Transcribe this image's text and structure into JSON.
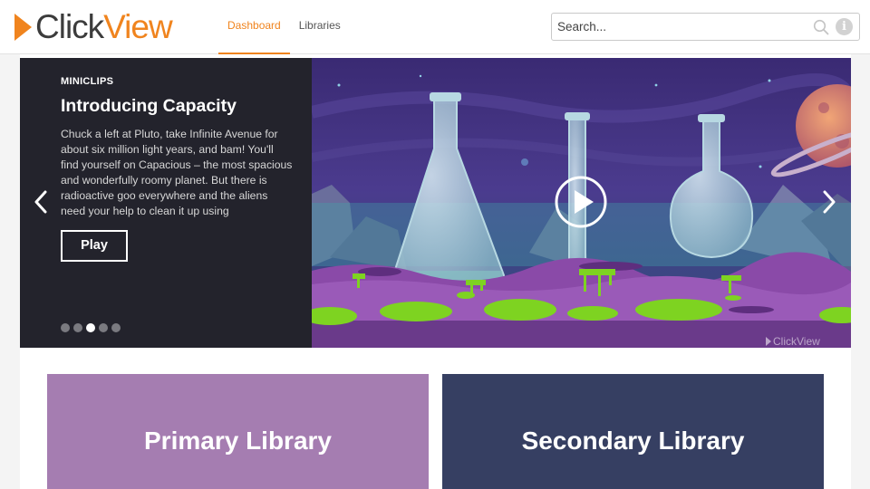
{
  "brand": {
    "logo_part1": "Click",
    "logo_part2": "View",
    "accent_color": "#f0841e"
  },
  "nav": {
    "items": [
      {
        "label": "Dashboard",
        "active": true
      },
      {
        "label": "Libraries",
        "active": false
      }
    ]
  },
  "search": {
    "placeholder": "Search...",
    "value": "",
    "icon": "search-icon",
    "info_icon": "info-icon",
    "info_glyph": "i"
  },
  "carousel": {
    "category": "MINICLIPS",
    "title": "Introducing Capacity",
    "description": "Chuck a left at Pluto, take Infinite Avenue for about six million light years, and bam! You'll find yourself on Capacious – the most spacious and wonderfully roomy planet. But there is radioactive goo everywhere and the aliens need your help to clean it up using",
    "play_label": "Play",
    "slide_count": 5,
    "active_slide": 3,
    "prev_icon": "chevron-left-icon",
    "next_icon": "chevron-right-icon",
    "video_play_icon": "play-circle-icon",
    "watermark_part1": "Click",
    "watermark_part2": "View"
  },
  "libraries": [
    {
      "label": "Primary Library",
      "color": "#a57db1"
    },
    {
      "label": "Secondary Library",
      "color": "#363f62"
    }
  ]
}
